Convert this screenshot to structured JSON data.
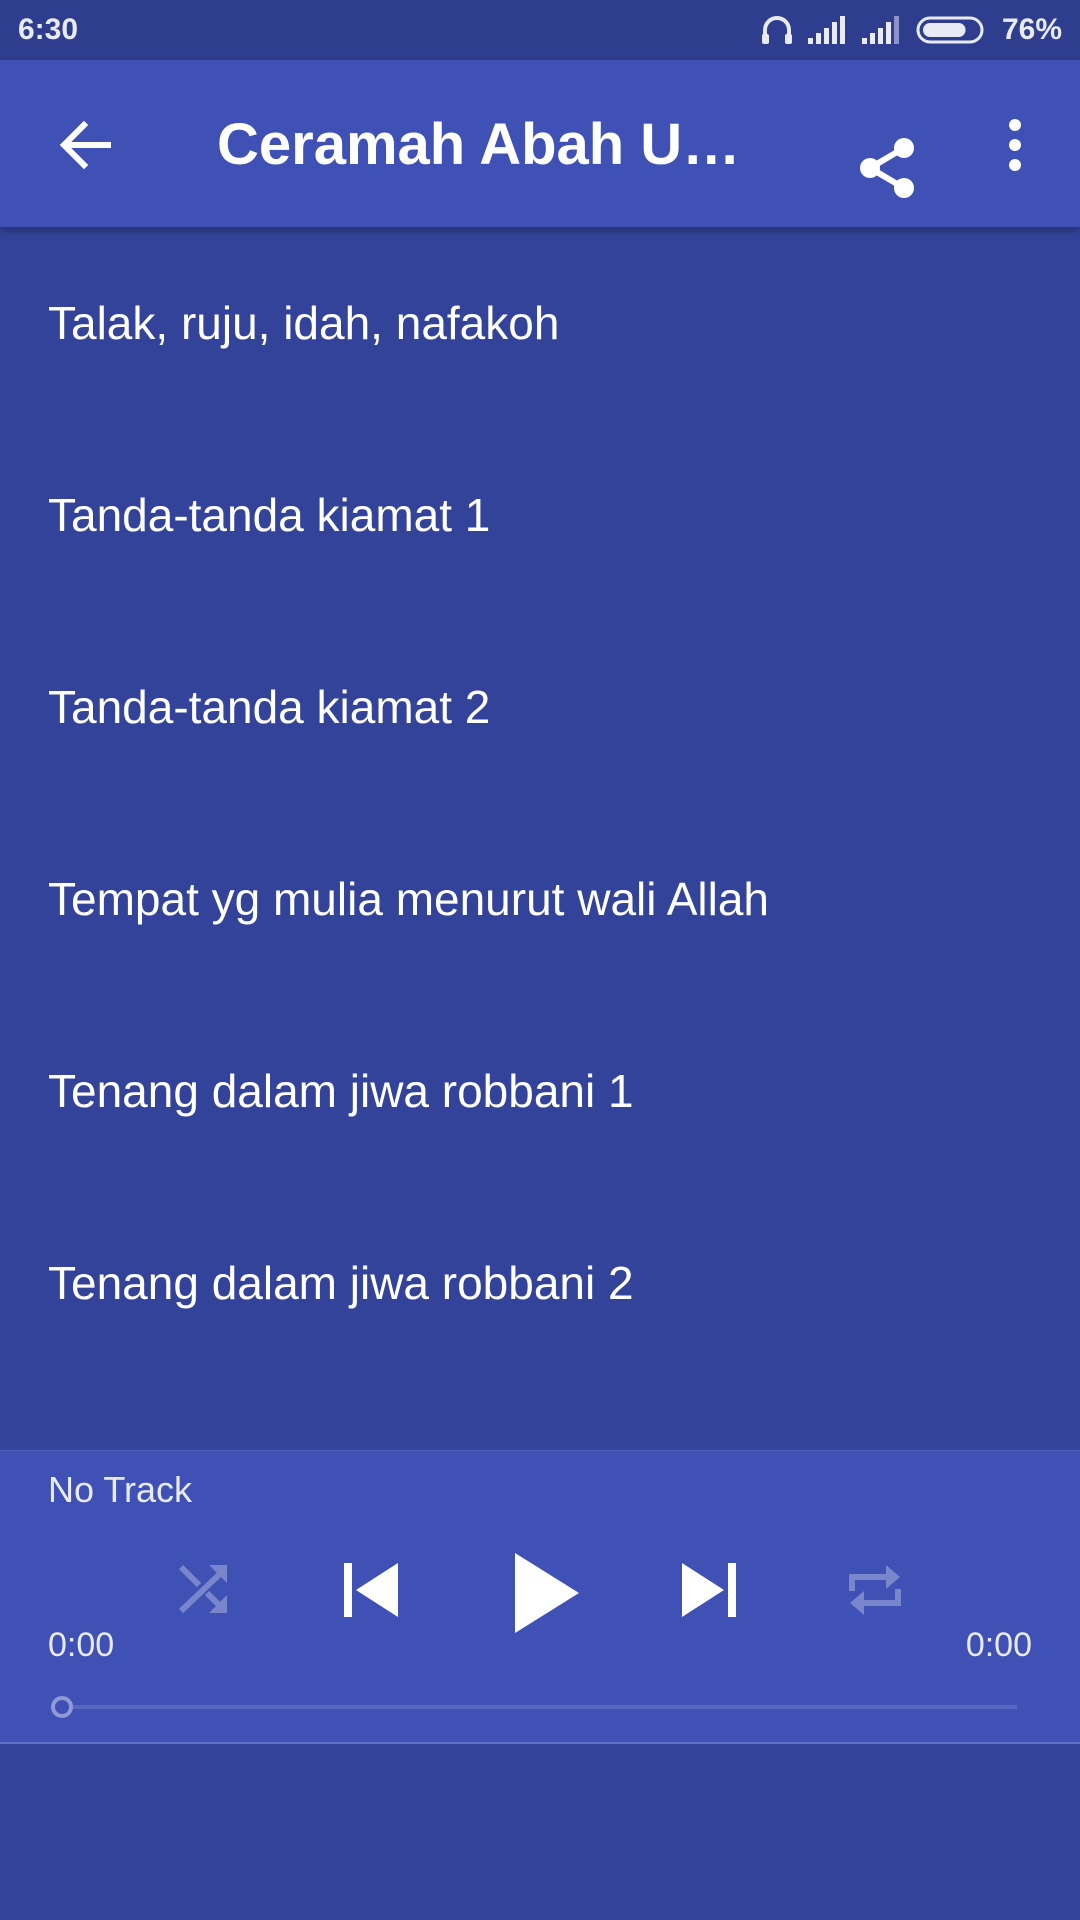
{
  "status_bar": {
    "time": "6:30",
    "battery_percent_label": "76%",
    "battery_level": 0.76,
    "icons": [
      "headphones-icon",
      "signal-icon",
      "signal-icon",
      "battery-icon"
    ]
  },
  "app_bar": {
    "title": "Ceramah Abah Uci...",
    "back_icon": "arrow-left-icon",
    "share_icon": "share-icon",
    "more_icon": "more-vert-icon"
  },
  "tracks": [
    {
      "title": "Talak, ruju, idah, nafakoh"
    },
    {
      "title": "Tanda-tanda kiamat 1"
    },
    {
      "title": "Tanda-tanda kiamat 2"
    },
    {
      "title": "Tempat yg mulia menurut wali Allah"
    },
    {
      "title": "Tenang dalam jiwa robbani 1"
    },
    {
      "title": "Tenang dalam jiwa robbani 2"
    }
  ],
  "player": {
    "now_playing": "No Track",
    "elapsed": "0:00",
    "duration": "0:00",
    "progress": 0,
    "controls": [
      "shuffle-icon",
      "skip-previous-icon",
      "play-icon",
      "skip-next-icon",
      "repeat-icon"
    ]
  },
  "colors": {
    "background": "#33439a",
    "app_bar": "#3f51b5",
    "status_bar": "#2f3d8e",
    "disabled_icon": "#7986cb"
  }
}
